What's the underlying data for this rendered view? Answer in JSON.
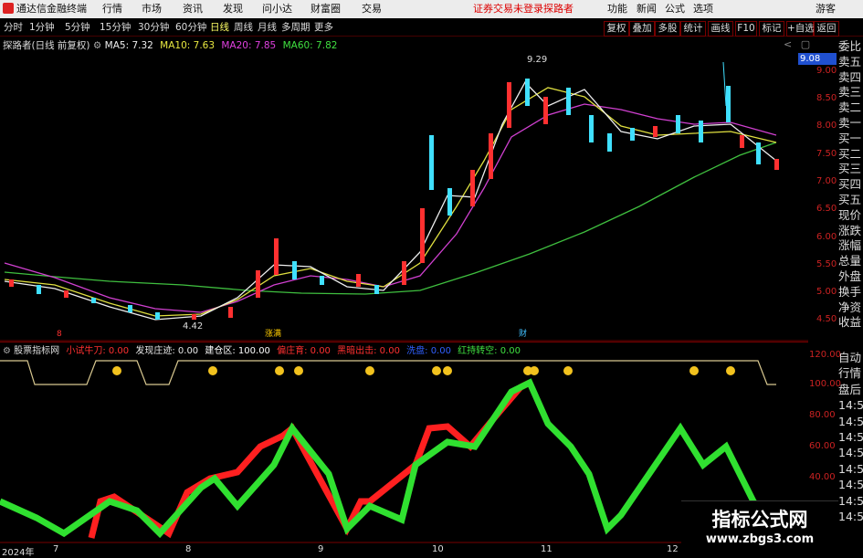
{
  "app": {
    "title": "通达信金融终端",
    "menu": [
      "行情",
      "市场",
      "资讯",
      "发现",
      "问小达",
      "财富圈",
      "交易"
    ],
    "notice": "证券交易未登录",
    "stock_short": "探路者",
    "right_menu": [
      "功能",
      "新闻",
      "公式",
      "选项"
    ],
    "user": "游客",
    "close": "×"
  },
  "periods": [
    "分时",
    "1分钟",
    "5分钟",
    "15分钟",
    "30分钟",
    "60分钟",
    "日线",
    "周线",
    "月线",
    "多周期",
    "更多"
  ],
  "toolbar": [
    "复权",
    "叠加",
    "多股",
    "统计",
    "画线",
    "F10",
    "标记",
    "+自选",
    "返回"
  ],
  "ma_info": {
    "name": "探路者(日线 前复权)",
    "ma5": "MA5: 7.32",
    "ma10": "MA10: 7.63",
    "ma20": "MA20: 7.85",
    "ma60": "MA60: 7.82"
  },
  "price_axis": {
    "ticks": [
      "9.00",
      "8.50",
      "8.00",
      "7.50",
      "7.00",
      "6.50",
      "6.00",
      "5.50",
      "5.00",
      "4.50"
    ],
    "current": "9.08",
    "high": "9.29",
    "low": "4.42"
  },
  "indicator": {
    "name": "股票指标网",
    "line": [
      {
        "t": "小试牛刀: 0.00",
        "c": "#ff3030"
      },
      {
        "t": "发现庄迹: 0.00",
        "c": "#e8e8e8"
      },
      {
        "t": "建仓区: 100.00",
        "c": "#ffffff"
      },
      {
        "t": "偏庄育: 0.00",
        "c": "#ff3030"
      },
      {
        "t": "黑暗出击: 0.00",
        "c": "#ff3030"
      },
      {
        "t": "洗盘: 0.00",
        "c": "#3060ff"
      },
      {
        "t": "红持转空: 0.00",
        "c": "#40e040"
      }
    ]
  },
  "ind_axis": {
    "ticks": [
      "120.00",
      "100.00",
      "80.00",
      "60.00",
      "40.00"
    ]
  },
  "right_quote": [
    "委比",
    "卖五",
    "卖四",
    "卖三",
    "卖二",
    "卖一",
    "买一",
    "买二",
    "买三",
    "买四",
    "买五",
    "现价",
    "涨跌",
    "涨幅",
    "总量",
    "外盘",
    "换手",
    "净资",
    "收益"
  ],
  "right_quote2": [
    "自动",
    "行情",
    "盘后",
    "14:5",
    "14:5",
    "14:5",
    "14:5",
    "14:5",
    "14:5",
    "14:5",
    "14:5"
  ],
  "x_axis": {
    "year": "2024年",
    "months": [
      "7",
      "8",
      "9",
      "10",
      "11",
      "12"
    ]
  },
  "markers": {
    "a": "8",
    "b": "涨满",
    "c": "财"
  },
  "watermark": {
    "title": "指标公式网",
    "url": "www.zbgs3.com"
  }
}
